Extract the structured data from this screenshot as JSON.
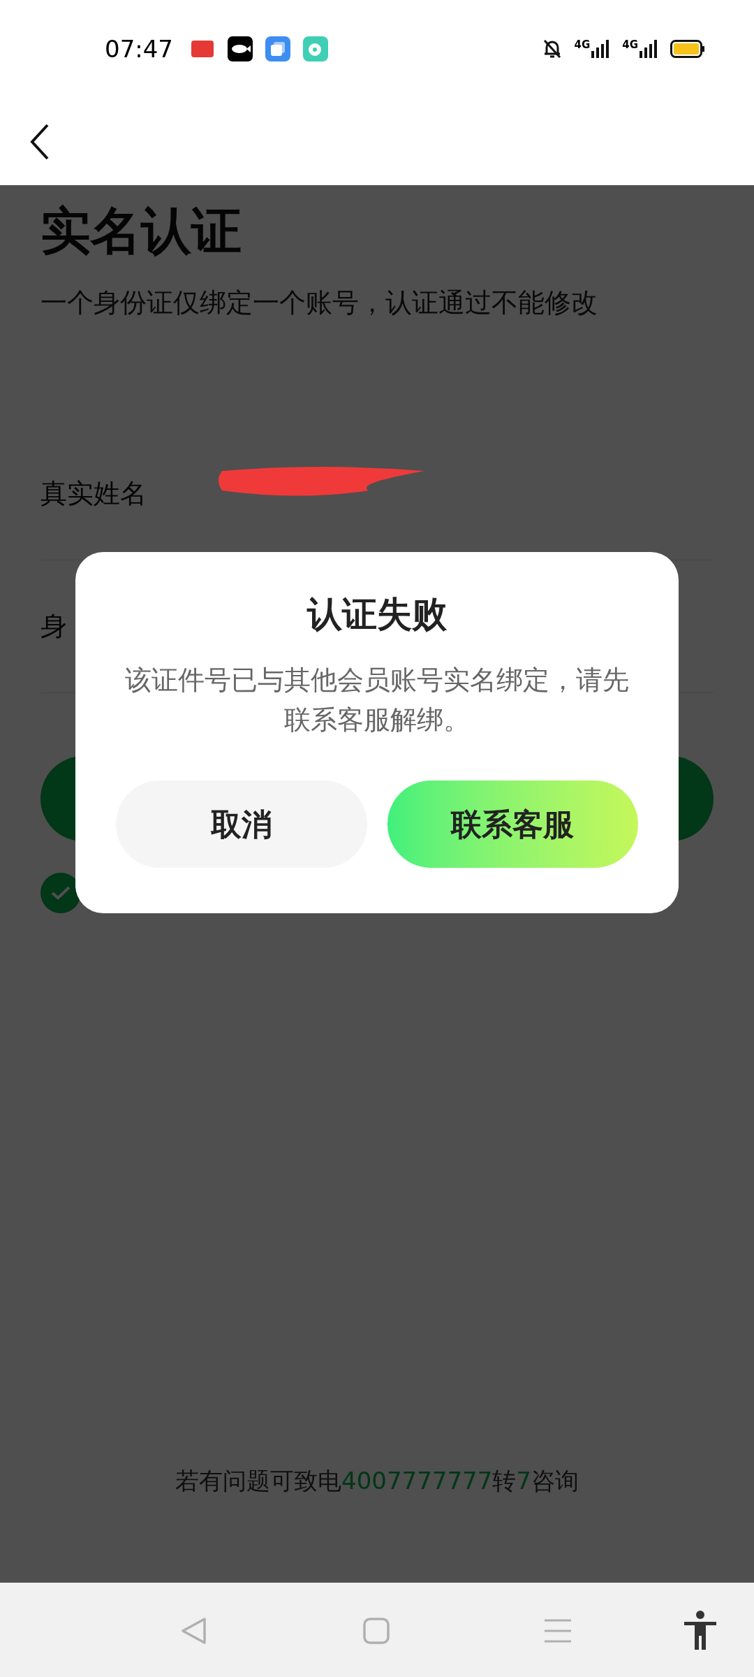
{
  "status_bar": {
    "time": "07:47",
    "signals": [
      "4G",
      "4G"
    ]
  },
  "page": {
    "title": "实名认证",
    "subtitle": "一个身份证仅绑定一个账号，认证通过不能修改",
    "fields": [
      {
        "label": "真实姓名",
        "redacted": true
      },
      {
        "label": "身"
      }
    ],
    "agreement": {
      "checked": true
    },
    "footer": [
      {
        "text": "若有问题可致电",
        "highlight": false
      },
      {
        "text": "4007777777",
        "highlight": true
      },
      {
        "text": "转",
        "highlight": false
      },
      {
        "text": "7",
        "highlight": true
      },
      {
        "text": "咨询",
        "highlight": false
      }
    ]
  },
  "dialog": {
    "title": "认证失败",
    "message": "该证件号已与其他会员账号实名绑定，请先联系客服解绑。",
    "buttons": [
      {
        "label": "取消",
        "kind": "secondary"
      },
      {
        "label": "联系客服",
        "kind": "primary"
      }
    ]
  }
}
